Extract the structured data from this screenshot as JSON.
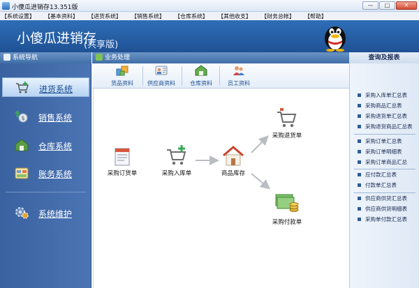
{
  "window": {
    "title": "小傻瓜进销存13.351版",
    "min": "—",
    "max": "□",
    "close": "✕"
  },
  "menu": [
    "【系统设置】",
    "【基本资料】",
    "【进货系统】",
    "【销售系统】",
    "【仓库系统】",
    "【其他收支】",
    "【财务总帐】",
    "【帮助】"
  ],
  "banner": {
    "app_name": "小傻瓜进销存",
    "edition": "(共享版)"
  },
  "left_header": "系统导航",
  "mid_header": "业务处理",
  "right_header": "查询及报表",
  "nav": [
    {
      "label": "进货系统",
      "icon": "cart-add-icon",
      "active": true
    },
    {
      "label": "销售系统",
      "icon": "coin-up-icon",
      "active": false
    },
    {
      "label": "仓库系统",
      "icon": "warehouse-icon",
      "active": false
    },
    {
      "label": "账务系统",
      "icon": "ledger-icon",
      "active": false
    },
    {
      "label": "系统维护",
      "icon": "gear-icon",
      "active": false
    }
  ],
  "tools": [
    {
      "label": "货品资料",
      "icon": "goods-icon"
    },
    {
      "label": "供应商资料",
      "icon": "supplier-icon"
    },
    {
      "label": "仓库资料",
      "icon": "warehouse-data-icon"
    },
    {
      "label": "员工资料",
      "icon": "staff-icon"
    }
  ],
  "flow": {
    "order": "采购订货单",
    "inbound": "采购入库单",
    "stock": "商品库存",
    "return": "采购退货单",
    "payment": "采购付款单"
  },
  "reports": [
    [
      "采购入库单汇总表",
      "采购商品汇总表",
      "采购退货单汇总表",
      "采购退货商品汇总表"
    ],
    [
      "采购订单汇总表",
      "采购订单明细表",
      "采购订单商品汇总"
    ],
    [
      "应付款汇总表",
      "付款单汇总表"
    ],
    [
      "供应商供货汇总表",
      "供应商供货明细表",
      "采购单付款汇总表"
    ]
  ],
  "colors": {
    "nav_bg": "#3f6aa8",
    "banner_bg": "#2a63aa",
    "accent": "#1d4f91"
  }
}
